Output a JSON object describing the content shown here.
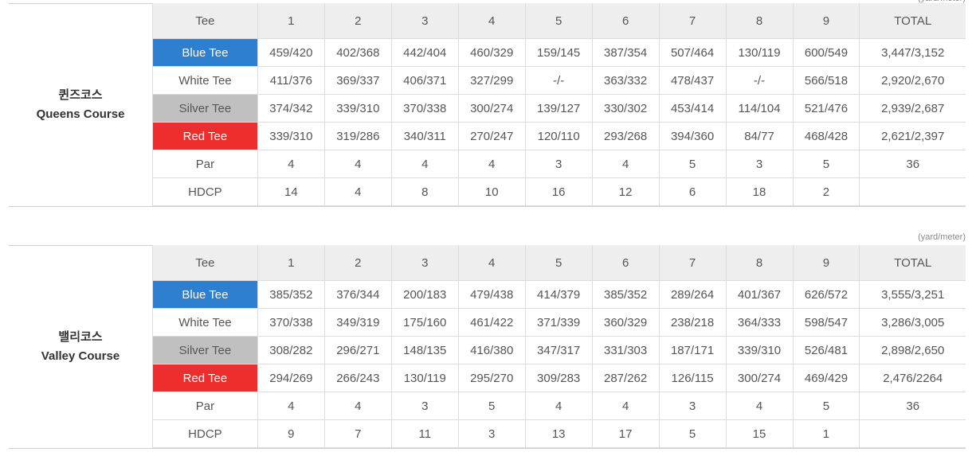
{
  "unit_label": "(yard/meter)",
  "courses": [
    {
      "name_ko": "퀸즈코스",
      "name_en": "Queens Course",
      "header": [
        "Tee",
        "1",
        "2",
        "3",
        "4",
        "5",
        "6",
        "7",
        "8",
        "9",
        "TOTAL"
      ],
      "rows": [
        {
          "tee": "Blue Tee",
          "color": "blue",
          "cells": [
            "459/420",
            "402/368",
            "442/404",
            "460/329",
            "159/145",
            "387/354",
            "507/464",
            "130/119",
            "600/549",
            "3,447/3,152"
          ]
        },
        {
          "tee": "White Tee",
          "color": "white",
          "cells": [
            "411/376",
            "369/337",
            "406/371",
            "327/299",
            "-/-",
            "363/332",
            "478/437",
            "-/-",
            "566/518",
            "2,920/2,670"
          ]
        },
        {
          "tee": "Silver Tee",
          "color": "silver",
          "cells": [
            "374/342",
            "339/310",
            "370/338",
            "300/274",
            "139/127",
            "330/302",
            "453/414",
            "114/104",
            "521/476",
            "2,939/2,687"
          ]
        },
        {
          "tee": "Red Tee",
          "color": "red",
          "cells": [
            "339/310",
            "319/286",
            "340/311",
            "270/247",
            "120/110",
            "293/268",
            "394/360",
            "84/77",
            "468/428",
            "2,621/2,397"
          ]
        },
        {
          "tee": "Par",
          "color": "none",
          "cells": [
            "4",
            "4",
            "4",
            "4",
            "3",
            "4",
            "5",
            "3",
            "5",
            "36"
          ]
        },
        {
          "tee": "HDCP",
          "color": "none",
          "cells": [
            "14",
            "4",
            "8",
            "10",
            "16",
            "12",
            "6",
            "18",
            "2",
            ""
          ]
        }
      ]
    },
    {
      "name_ko": "밸리코스",
      "name_en": "Valley Course",
      "header": [
        "Tee",
        "1",
        "2",
        "3",
        "4",
        "5",
        "6",
        "7",
        "8",
        "9",
        "TOTAL"
      ],
      "rows": [
        {
          "tee": "Blue Tee",
          "color": "blue",
          "cells": [
            "385/352",
            "376/344",
            "200/183",
            "479/438",
            "414/379",
            "385/352",
            "289/264",
            "401/367",
            "626/572",
            "3,555/3,251"
          ]
        },
        {
          "tee": "White Tee",
          "color": "white",
          "cells": [
            "370/338",
            "349/319",
            "175/160",
            "461/422",
            "371/339",
            "360/329",
            "238/218",
            "364/333",
            "598/547",
            "3,286/3,005"
          ]
        },
        {
          "tee": "Silver Tee",
          "color": "silver",
          "cells": [
            "308/282",
            "296/271",
            "148/135",
            "416/380",
            "347/317",
            "331/303",
            "187/171",
            "339/310",
            "526/481",
            "2,898/2,650"
          ]
        },
        {
          "tee": "Red Tee",
          "color": "red",
          "cells": [
            "294/269",
            "266/243",
            "130/119",
            "295/270",
            "309/283",
            "287/262",
            "126/115",
            "300/274",
            "469/429",
            "2,476/2264"
          ]
        },
        {
          "tee": "Par",
          "color": "none",
          "cells": [
            "4",
            "4",
            "3",
            "5",
            "4",
            "4",
            "3",
            "4",
            "5",
            "36"
          ]
        },
        {
          "tee": "HDCP",
          "color": "none",
          "cells": [
            "9",
            "7",
            "11",
            "3",
            "13",
            "17",
            "5",
            "15",
            "1",
            ""
          ]
        }
      ]
    }
  ]
}
